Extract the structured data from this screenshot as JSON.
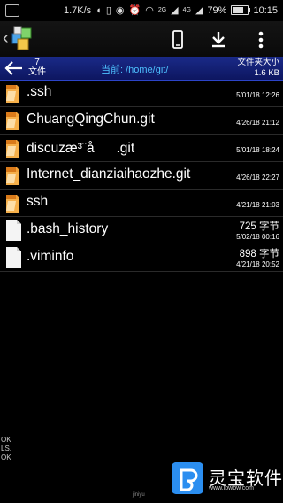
{
  "status_bar": {
    "net_speed": "1.7K/s",
    "signal_2g": "2G",
    "signal_4g": "4G",
    "battery": "79%",
    "battery_level": 0.79,
    "time": "10:15"
  },
  "toolbar": {
    "back_icon": "chevron-left-icon",
    "logo_icon": "app-logo-icon",
    "phone_icon": "phone-icon",
    "download_icon": "download-icon",
    "more_icon": "more-vertical-icon"
  },
  "path_bar": {
    "count": "7",
    "count_unit": "文件",
    "current_path": "当前: /home/git/",
    "folder_size_label": "文件夹大小",
    "folder_size_value": "1.6 KB"
  },
  "files": [
    {
      "name": ".ssh",
      "type": "folder",
      "size": "",
      "date": "5/01/18 12:26"
    },
    {
      "name": "ChuangQingChun.git",
      "type": "folder",
      "size": "",
      "date": "4/26/18 21:12"
    },
    {
      "name": "discuzæ³¨å.git",
      "type": "folder",
      "size": "",
      "date": "5/01/18 18:24"
    },
    {
      "name": "Internet_dianziaihaozhe.git",
      "type": "folder",
      "size": "",
      "date": "4/26/18 22:27"
    },
    {
      "name": "ssh",
      "type": "folder",
      "size": "",
      "date": "4/21/18 21:03"
    },
    {
      "name": ".bash_history",
      "type": "file",
      "size": "725 字节",
      "date": "5/02/18 00:16"
    },
    {
      "name": ".viminfo",
      "type": "file",
      "size": "898 字节",
      "date": "4/21/18 20:52"
    }
  ],
  "log": "OK\nLS.\nOK",
  "watermark": {
    "title": "灵宝软件",
    "url": "www.lbwbw.com",
    "small": "jiniyu"
  }
}
